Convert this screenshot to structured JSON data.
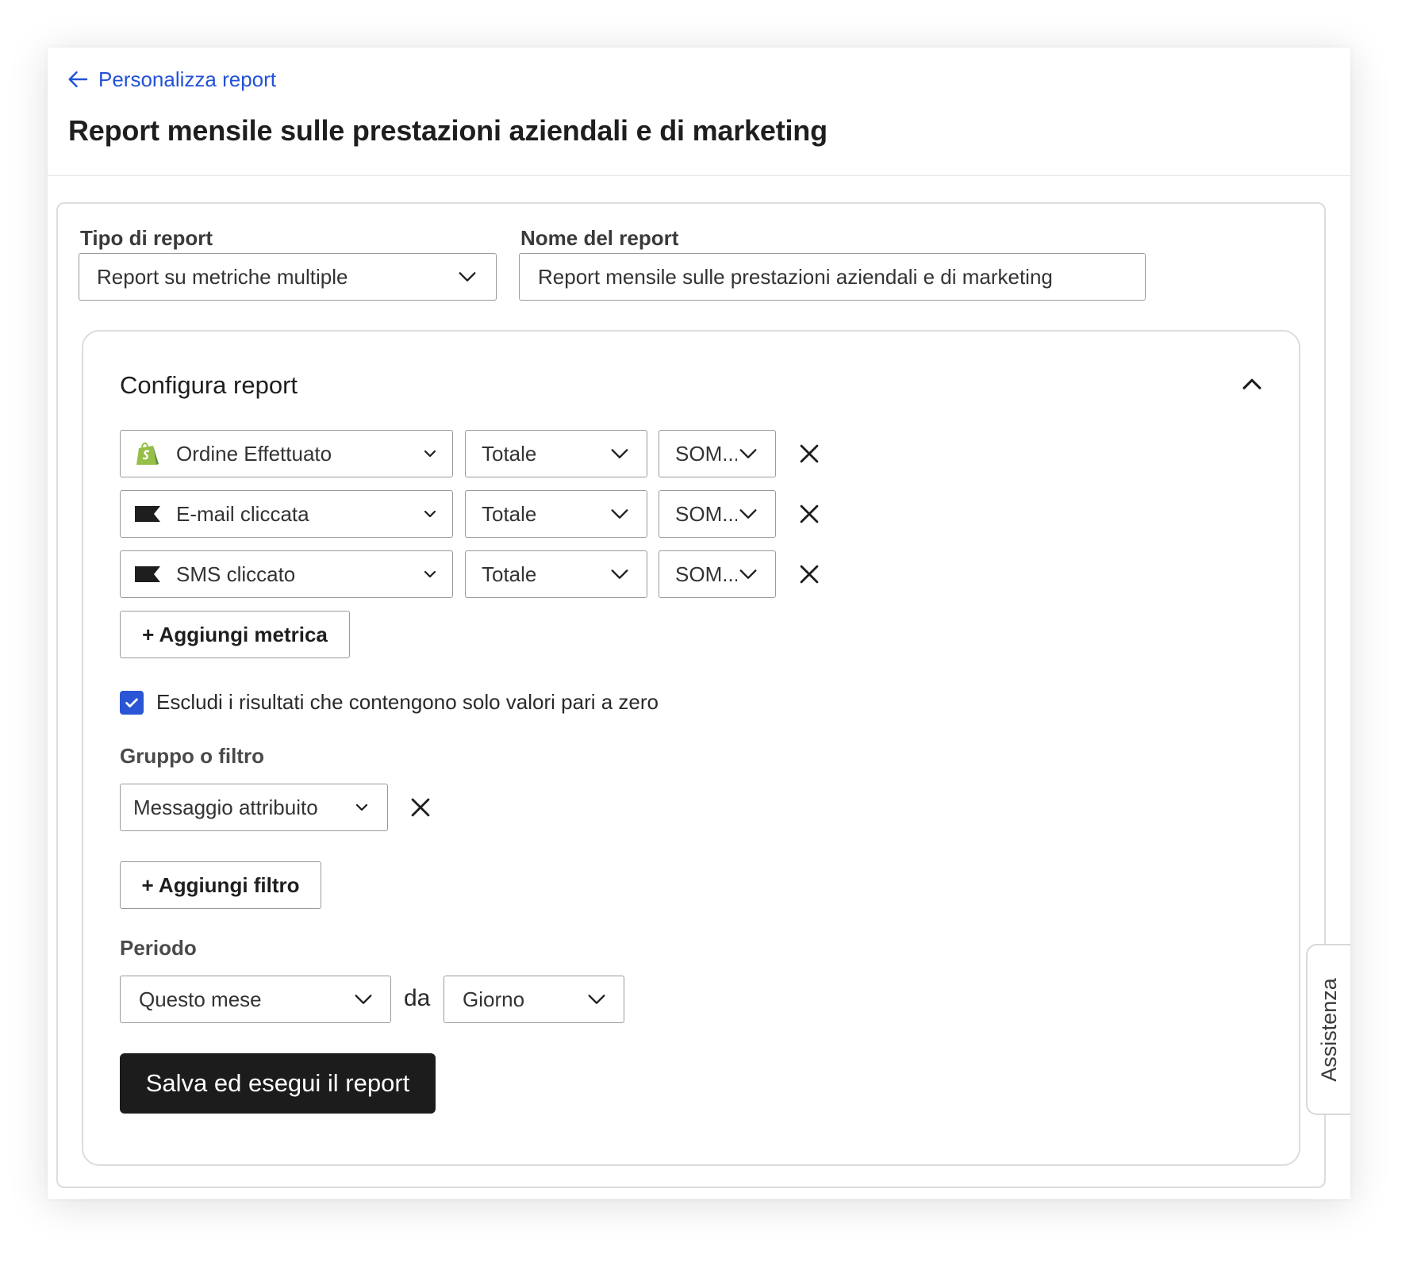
{
  "header": {
    "back_label": "Personalizza report",
    "title": "Report mensile sulle prestazioni aziendali e di marketing"
  },
  "form": {
    "report_type": {
      "label": "Tipo di report",
      "value": "Report su metriche multiple"
    },
    "report_name": {
      "label": "Nome del report",
      "value": "Report mensile sulle prestazioni aziendali e di marketing"
    }
  },
  "configure": {
    "title": "Configura report",
    "metrics": [
      {
        "event": "Ordine Effettuato",
        "icon": "shopify-icon",
        "measure": "Totale",
        "aggregation": "SOM..."
      },
      {
        "event": "E-mail cliccata",
        "icon": "flag-icon",
        "measure": "Totale",
        "aggregation": "SOM..."
      },
      {
        "event": "SMS cliccato",
        "icon": "flag-icon",
        "measure": "Totale",
        "aggregation": "SOM..."
      }
    ],
    "add_metric_label": "+ Aggiungi metrica",
    "exclude_zero": {
      "label": "Escludi i risultati che contengono solo valori pari a zero",
      "checked": true
    },
    "group_filter": {
      "label": "Gruppo o filtro",
      "value": "Messaggio attribuito"
    },
    "add_filter_label": "+ Aggiungi filtro",
    "period": {
      "label": "Periodo",
      "range": "Questo mese",
      "connector": "da",
      "granularity": "Giorno"
    },
    "save_label": "Salva ed esegui il report"
  },
  "help_tab": {
    "label": "Assistenza"
  },
  "colors": {
    "link": "#2352d8",
    "checkbox": "#2a55d4",
    "primary_button": "#1c1c1c",
    "shopify_green": "#95bf47"
  }
}
